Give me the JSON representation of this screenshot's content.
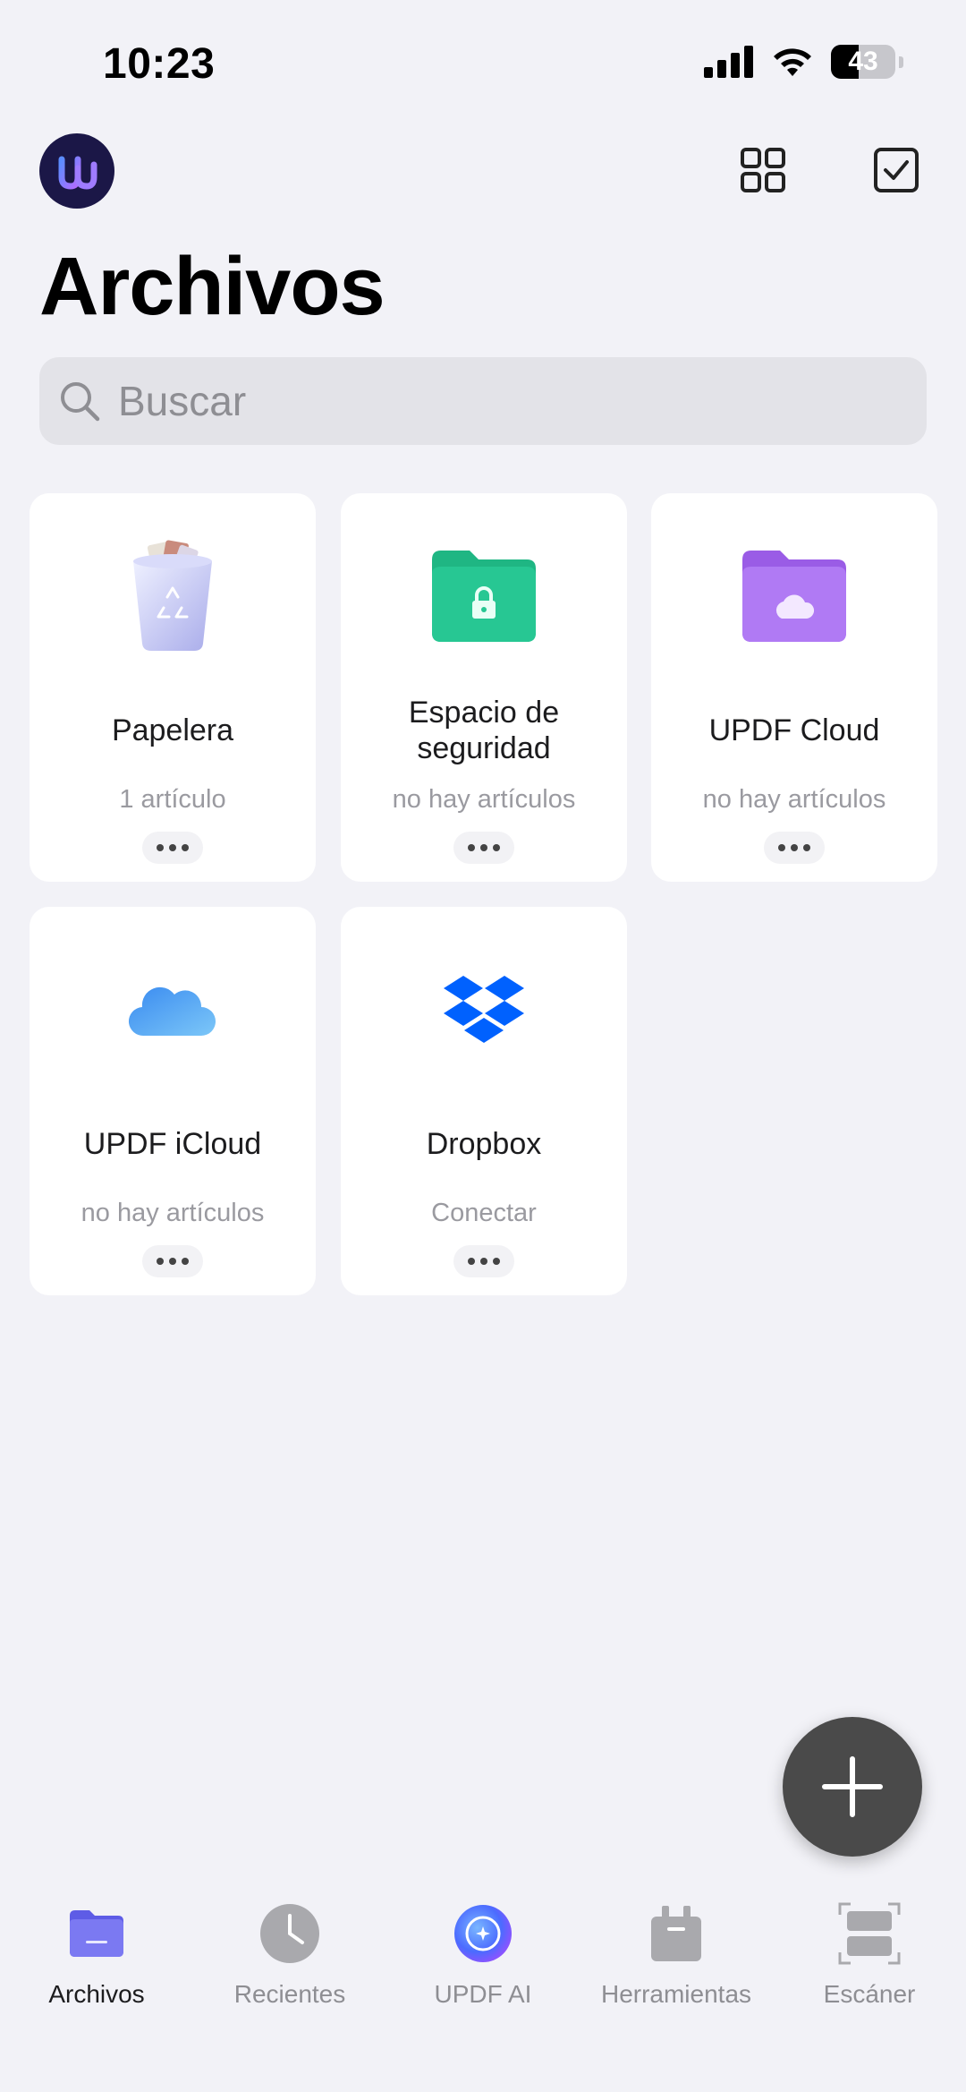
{
  "status_bar": {
    "time": "10:23",
    "battery": "43"
  },
  "header": {
    "title": "Archivos"
  },
  "search": {
    "placeholder": "Buscar"
  },
  "cards": [
    {
      "name": "Papelera",
      "sub": "1 artículo",
      "icon": "trash-icon"
    },
    {
      "name": "Espacio de seguridad",
      "sub": "no hay artículos",
      "icon": "secure-folder-icon"
    },
    {
      "name": "UPDF Cloud",
      "sub": "no hay artículos",
      "icon": "cloud-folder-icon"
    },
    {
      "name": "UPDF iCloud",
      "sub": "no hay artículos",
      "icon": "icloud-icon"
    },
    {
      "name": "Dropbox",
      "sub": "Conectar",
      "icon": "dropbox-icon"
    }
  ],
  "tabs": [
    {
      "label": "Archivos",
      "icon": "folder-icon",
      "active": true
    },
    {
      "label": "Recientes",
      "icon": "clock-icon",
      "active": false
    },
    {
      "label": "UPDF AI",
      "icon": "ai-icon",
      "active": false
    },
    {
      "label": "Herramientas",
      "icon": "toolbox-icon",
      "active": false
    },
    {
      "label": "Escáner",
      "icon": "scanner-icon",
      "active": false
    }
  ],
  "colors": {
    "background": "#f2f2f7",
    "secure_folder": "#22c08c",
    "cloud_folder": "#a86cf0",
    "dropbox": "#0061fe",
    "active_tab": "#6e6cf2",
    "fab": "#4a4a4a"
  }
}
